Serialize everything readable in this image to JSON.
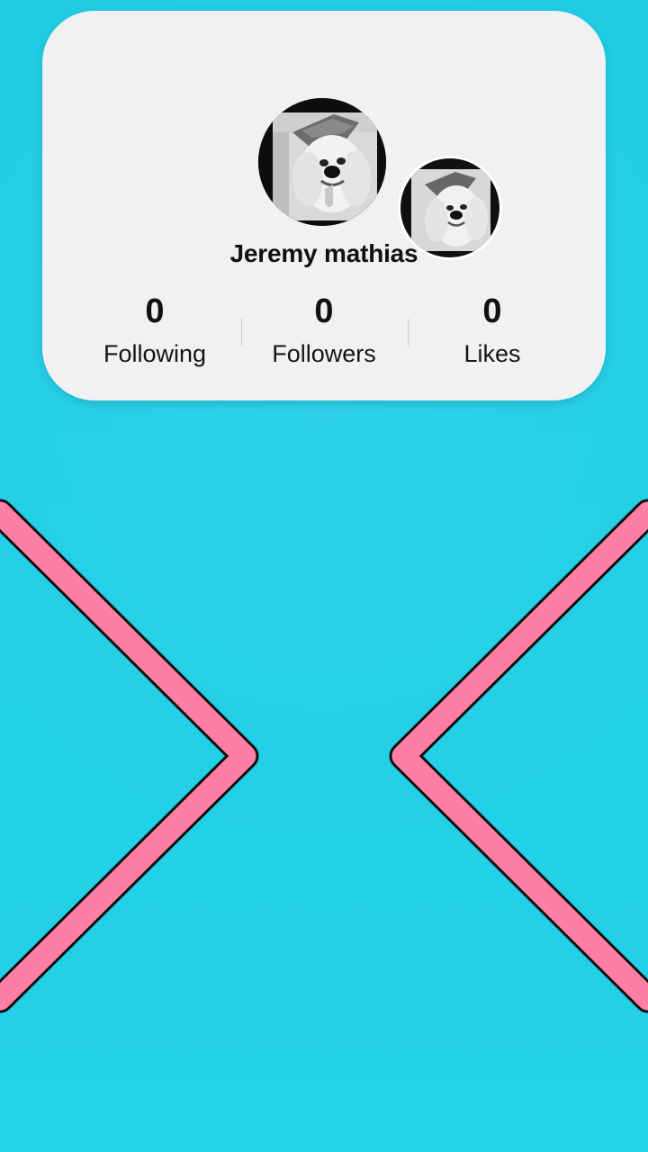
{
  "profile": {
    "name": "Jeremy mathias",
    "avatar_main": "dog-avatar-image",
    "avatar_secondary": "dog-avatar-image"
  },
  "stats": [
    {
      "label": "Following",
      "value": "0"
    },
    {
      "label": "Followers",
      "value": "0"
    },
    {
      "label": "Likes",
      "value": "0"
    }
  ],
  "colors": {
    "background": "#22cfe6",
    "card": "#f1f1f3",
    "accent": "#ff7ea5",
    "outline": "#111111"
  },
  "decor": {
    "left_shape": "right-pointing-chevron",
    "right_shape": "left-pointing-chevron"
  }
}
